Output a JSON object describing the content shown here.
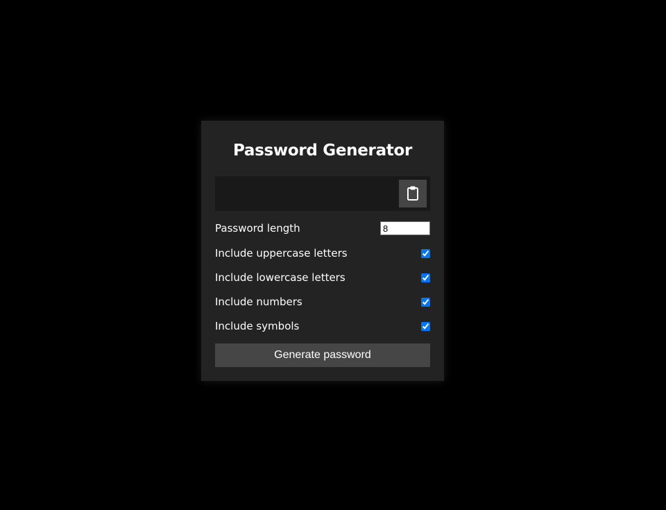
{
  "title": "Password Generator",
  "result": {
    "value": ""
  },
  "clipboard": {
    "icon": "clipboard-icon"
  },
  "settings": {
    "length": {
      "label": "Password length",
      "value": "8"
    },
    "uppercase": {
      "label": "Include uppercase letters",
      "checked": true
    },
    "lowercase": {
      "label": "Include lowercase letters",
      "checked": true
    },
    "numbers": {
      "label": "Include numbers",
      "checked": true
    },
    "symbols": {
      "label": "Include symbols",
      "checked": true
    }
  },
  "generate_button": {
    "label": "Generate password"
  },
  "colors": {
    "page_background": "#000000",
    "card_background": "#232323",
    "result_background": "#191919",
    "button_background": "#464646",
    "checkbox_accent": "#0075ff",
    "text": "#ffffff"
  }
}
